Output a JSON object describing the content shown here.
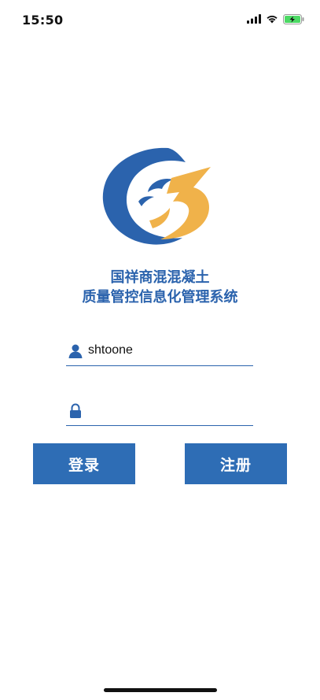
{
  "status_bar": {
    "time": "15:50",
    "icons": [
      "signal-icon",
      "wifi-icon",
      "battery-charging-icon"
    ]
  },
  "app": {
    "logo_icon": "company-logo",
    "title_line1": "国祥商混混凝土",
    "title_line2": "质量管控信息化管理系统"
  },
  "form": {
    "username_value": "shtoone",
    "username_icon": "user-icon",
    "password_value": "",
    "password_icon": "lock-icon"
  },
  "buttons": {
    "login_label": "登录",
    "register_label": "注册"
  },
  "colors": {
    "brand_blue": "#2e6db5",
    "logo_orange": "#f0b24a"
  }
}
